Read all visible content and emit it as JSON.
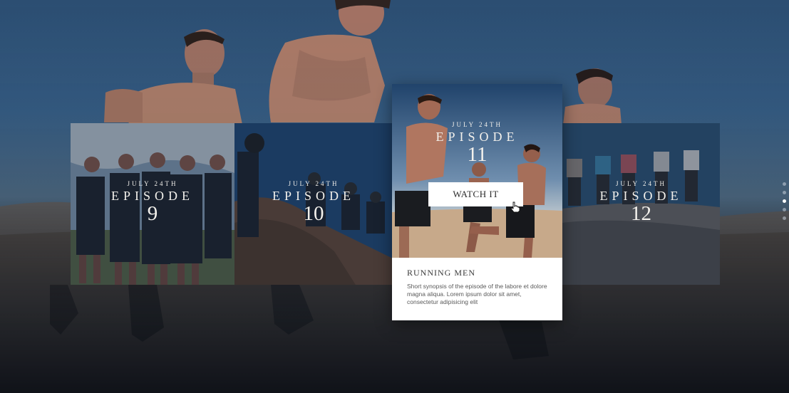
{
  "episodes": [
    {
      "date": "JULY 24TH",
      "word": "EPISODE",
      "number": "9"
    },
    {
      "date": "JULY 24TH",
      "word": "EPISODE",
      "number": "10"
    },
    {
      "date": "JULY 24TH",
      "word": "EPISODE",
      "number": "11"
    },
    {
      "date": "JULY 24TH",
      "word": "EPISODE",
      "number": "12"
    }
  ],
  "featured": {
    "button_label": "WATCH IT",
    "title": "RUNNING MEN",
    "synopsis": "Short synopsis of the episode of the labore et dolore magna aliqua. Lorem ipsum dolor sit amet, consectetur adipisicing elit"
  },
  "pager": {
    "count": 5,
    "active_index": 2
  },
  "icons": {
    "cursor": "hand-pointer-icon"
  }
}
